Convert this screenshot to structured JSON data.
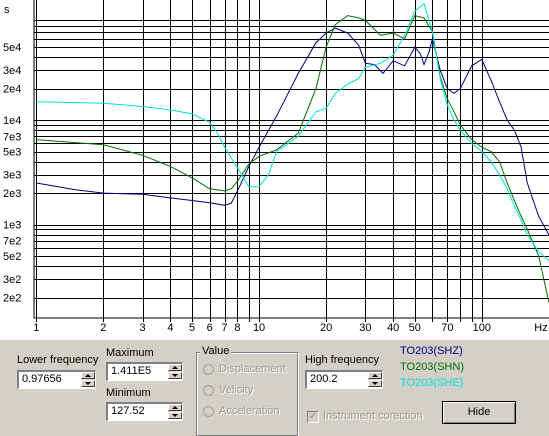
{
  "chart_data": {
    "type": "line",
    "x_scale": "log",
    "y_scale": "log",
    "xlim": [
      0.97656,
      200.2
    ],
    "ylim": [
      127.52,
      141100
    ],
    "grid": true,
    "xlabel": "Hz",
    "ylabel": "s",
    "x_ticks": [
      {
        "v": 1,
        "l": "1"
      },
      {
        "v": 2,
        "l": "2"
      },
      {
        "v": 3,
        "l": "3"
      },
      {
        "v": 4,
        "l": "4"
      },
      {
        "v": 5,
        "l": "5"
      },
      {
        "v": 6,
        "l": "6"
      },
      {
        "v": 7,
        "l": "7"
      },
      {
        "v": 8,
        "l": "8"
      },
      {
        "v": 10,
        "l": "10"
      },
      {
        "v": 20,
        "l": "20"
      },
      {
        "v": 30,
        "l": "30"
      },
      {
        "v": 40,
        "l": "40"
      },
      {
        "v": 50,
        "l": "50"
      },
      {
        "v": 70,
        "l": "70"
      },
      {
        "v": 100,
        "l": "100"
      }
    ],
    "x_minor": [
      9,
      60,
      80,
      90
    ],
    "y_ticks": [
      {
        "v": 200,
        "l": "2e2"
      },
      {
        "v": 300,
        "l": "3e2"
      },
      {
        "v": 500,
        "l": "5e2"
      },
      {
        "v": 700,
        "l": "7e2"
      },
      {
        "v": 1000,
        "l": "1e3"
      },
      {
        "v": 2000,
        "l": "2e3"
      },
      {
        "v": 3000,
        "l": "3e3"
      },
      {
        "v": 5000,
        "l": "5e3"
      },
      {
        "v": 7000,
        "l": "7e3"
      },
      {
        "v": 10000,
        "l": "1e4"
      },
      {
        "v": 20000,
        "l": "2e4"
      },
      {
        "v": 30000,
        "l": "3e4"
      },
      {
        "v": 50000,
        "l": "5e4"
      }
    ],
    "y_minor": [
      400,
      600,
      800,
      900,
      4000,
      6000,
      8000,
      9000,
      40000,
      60000,
      70000,
      80000,
      90000
    ],
    "series": [
      {
        "name": "TO203(SHZ)",
        "color": "#000080",
        "x": [
          1,
          1.5,
          2,
          3,
          4,
          5,
          6,
          7,
          7.5,
          8,
          9,
          10,
          12,
          15,
          18,
          20,
          22,
          25,
          28,
          30,
          33,
          36,
          40,
          45,
          50,
          53,
          55,
          58,
          60,
          65,
          70,
          75,
          80,
          90,
          100,
          110,
          120,
          130,
          140,
          150,
          160,
          180,
          200
        ],
        "y": [
          2500,
          2150,
          2000,
          1950,
          1800,
          1700,
          1620,
          1530,
          1600,
          2100,
          3600,
          5500,
          11000,
          28000,
          55000,
          68000,
          76000,
          68000,
          52000,
          35000,
          34000,
          28000,
          37000,
          33000,
          50000,
          43000,
          34000,
          45000,
          60000,
          30000,
          20000,
          18000,
          20000,
          33000,
          38000,
          24000,
          15000,
          10000,
          8000,
          5500,
          2500,
          1200,
          800
        ]
      },
      {
        "name": "TO203(SHN)",
        "color": "#007000",
        "x": [
          1,
          2,
          3,
          4,
          5,
          6,
          7,
          7.5,
          8,
          9,
          10,
          12,
          15,
          18,
          20,
          22,
          25,
          28,
          30,
          35,
          40,
          45,
          50,
          55,
          60,
          65,
          70,
          75,
          80,
          90,
          100,
          110,
          120,
          130,
          140,
          150,
          160,
          180,
          200
        ],
        "y": [
          6500,
          5800,
          4600,
          3600,
          2800,
          2200,
          2100,
          2200,
          2600,
          3800,
          4500,
          5200,
          7500,
          20000,
          50000,
          82000,
          100000,
          95000,
          90000,
          65000,
          68000,
          60000,
          100000,
          95000,
          70000,
          26000,
          16000,
          12000,
          9000,
          6500,
          5500,
          5000,
          4000,
          2500,
          1700,
          1200,
          900,
          500,
          180
        ]
      },
      {
        "name": "TO203(SHE)",
        "color": "#00e0e0",
        "x": [
          1,
          2,
          3,
          4,
          5,
          6,
          6.5,
          7,
          8,
          9,
          10,
          11,
          12,
          15,
          18,
          20,
          22,
          25,
          28,
          30,
          35,
          40,
          45,
          50,
          55,
          60,
          65,
          70,
          75,
          80,
          90,
          100,
          110,
          120,
          130,
          140,
          150,
          160,
          180,
          200
        ],
        "y": [
          15000,
          14500,
          13500,
          12500,
          11500,
          9500,
          7500,
          5500,
          3500,
          2300,
          2300,
          3000,
          5000,
          7000,
          12000,
          13000,
          18000,
          22000,
          25000,
          32000,
          35000,
          42000,
          65000,
          110000,
          130000,
          70000,
          25000,
          14000,
          10000,
          8000,
          6000,
          5000,
          4000,
          3000,
          2200,
          1500,
          1100,
          800,
          550,
          450
        ]
      }
    ]
  },
  "controls": {
    "lower_frequency_label": "Lower frequency",
    "lower_frequency_value": "0.97656",
    "maximum_label": "Maximum",
    "maximum_value": "1.411E5",
    "minimum_label": "Minimum",
    "minimum_value": "127.52",
    "value_group_title": "Value",
    "value_options": [
      "Displacement",
      "Velicity",
      "Acceleration"
    ],
    "high_frequency_label": "High frequency",
    "high_frequency_value": "200.2",
    "instrument_correction_label": "Instrument corection",
    "hide_button": "Hide"
  },
  "legend": [
    {
      "label": "TO203(SHZ)",
      "color": "#000080"
    },
    {
      "label": "TO203(SHN)",
      "color": "#007000"
    },
    {
      "label": "TO203(SHE)",
      "color": "#00e0e0"
    }
  ]
}
